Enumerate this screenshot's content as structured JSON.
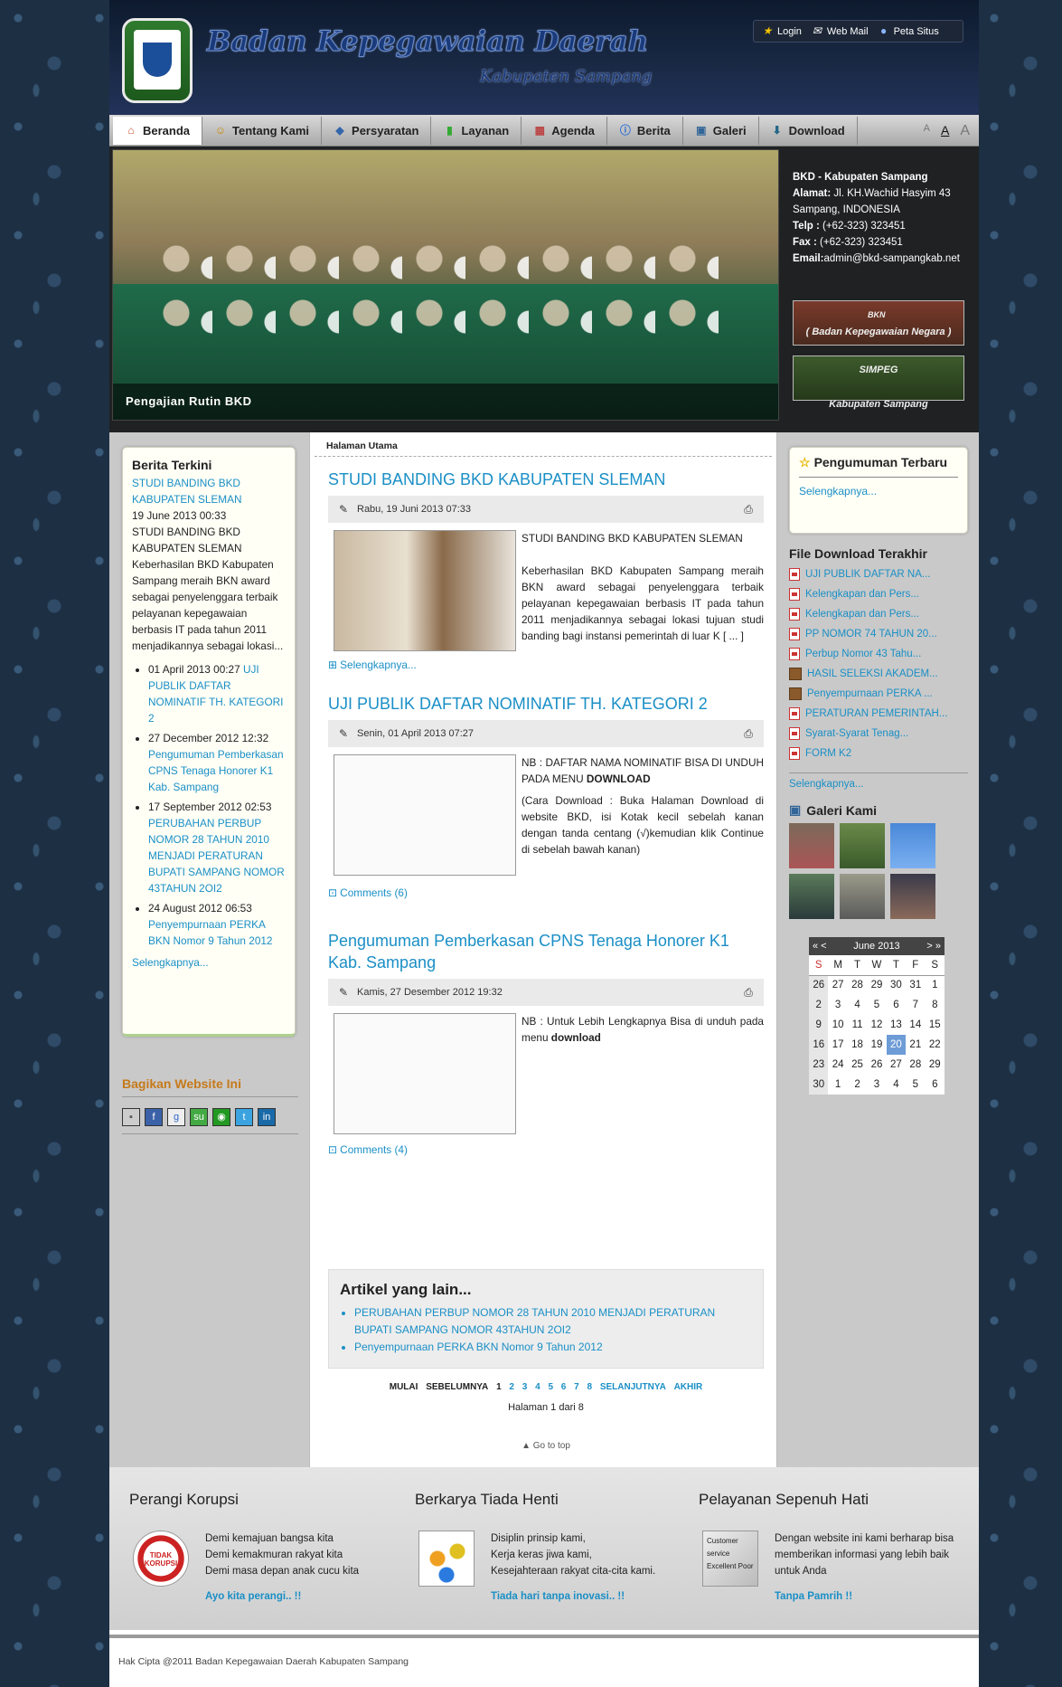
{
  "header": {
    "title": "Badan Kepegawaian Daerah",
    "subtitle": "Kabupaten Sampang",
    "links": [
      {
        "label": "Login"
      },
      {
        "label": "Web Mail"
      },
      {
        "label": "Peta Situs"
      }
    ]
  },
  "nav": {
    "items": [
      {
        "label": "Beranda"
      },
      {
        "label": "Tentang Kami"
      },
      {
        "label": "Persyaratan"
      },
      {
        "label": "Layanan"
      },
      {
        "label": "Agenda"
      },
      {
        "label": "Berita"
      },
      {
        "label": "Galeri"
      },
      {
        "label": "Download"
      }
    ],
    "font_sizes": [
      "A",
      "A",
      "A"
    ]
  },
  "slider": {
    "caption": "Pengajian Rutin BKD"
  },
  "contact": {
    "org": "BKD - Kabupaten Sampang",
    "alamat_label": "Alamat:",
    "alamat": "Jl. KH.Wachid Hasyim 43 Sampang, INDONESIA",
    "telp_label": "Telp :",
    "telp": "(+62-323) 323451",
    "fax_label": "Fax :",
    "fax": "(+62-323) 323451",
    "email_label": "Email:",
    "email": "admin@bkd-sampangkab.net"
  },
  "banners": {
    "bkn": "( Badan Kepegawaian Negara )",
    "bkn_small": "BKN",
    "simpeg": "SIMPEG",
    "simpeg_sub": "Kabupaten Sampang"
  },
  "left": {
    "berita_title": "Berita Terkini",
    "lead_link": "STUDI BANDING BKD KABUPATEN SLEMAN",
    "lead_date": "19 June 2013 00:33",
    "lead_text": "STUDI BANDING BKD KABUPATEN SLEMAN Keberhasilan BKD Kabupaten Sampang meraih BKN award sebagai penyelenggara terbaik pelayanan kepegawaian berbasis IT pada tahun 2011 menjadikannya sebagai lokasi...",
    "items": [
      {
        "date": "01 April 2013 00:27",
        "title": "UJI PUBLIK DAFTAR NOMINATIF TH. KATEGORI 2"
      },
      {
        "date": "27 December 2012 12:32",
        "title": "Pengumuman Pemberkasan CPNS Tenaga Honorer K1 Kab. Sampang"
      },
      {
        "date": "17 September 2012 02:53",
        "title": "PERUBAHAN PERBUP NOMOR 28 TAHUN 2010 MENJADI PERATURAN BUPATI SAMPANG NOMOR 43TAHUN 2OI2"
      },
      {
        "date": "24 August 2012 06:53",
        "title": "Penyempurnaan PERKA BKN Nomor 9 Tahun 2012"
      }
    ],
    "more": "Selengkapnya...",
    "share_title": "Bagikan Website Ini"
  },
  "main": {
    "breadcrumb": "Halaman Utama",
    "articles": [
      {
        "title": "STUDI BANDING BKD KABUPATEN SLEMAN",
        "date": "Rabu, 19 Juni 2013 07:33",
        "text1": "STUDI BANDING BKD KABUPATEN SLEMAN",
        "text2": "Keberhasilan BKD Kabupaten Sampang meraih BKN award sebagai penyelenggara terbaik pelayanan kepegawaian berbasis IT pada tahun 2011 menjadikannya sebagai lokasi tujuan studi banding bagi instansi pemerintah di luar K [ ... ]",
        "link": "Selengkapnya..."
      },
      {
        "title": "UJI PUBLIK DAFTAR NOMINATIF TH. KATEGORI 2",
        "date": "Senin, 01 April 2013 07:27",
        "text1": "NB : DAFTAR NAMA NOMINATIF BISA DI UNDUH PADA MENU",
        "bold1": "DOWNLOAD",
        "text2": "(Cara Download : Buka Halaman Download di website BKD, isi Kotak kecil sebelah kanan dengan tanda centang (√)kemudian klik Continue di sebelah bawah kanan)",
        "link": "Comments (6)"
      },
      {
        "title": "Pengumuman Pemberkasan CPNS Tenaga Honorer K1 Kab. Sampang",
        "date": "Kamis, 27 Desember 2012 19:32",
        "text1": "NB : Untuk Lebih Lengkapnya Bisa di unduh pada menu",
        "bold1": "download",
        "link": "Comments (4)"
      }
    ],
    "other_title": "Artikel yang lain...",
    "other": [
      "PERUBAHAN PERBUP NOMOR 28 TAHUN 2010 MENJADI PERATURAN BUPATI SAMPANG NOMOR 43TAHUN 2OI2",
      "Penyempurnaan PERKA BKN Nomor 9 Tahun 2012"
    ],
    "pager": {
      "first": "MULAI",
      "prev": "SEBELUMNYA",
      "pages": [
        "1",
        "2",
        "3",
        "4",
        "5",
        "6",
        "7",
        "8"
      ],
      "next": "SELANJUTNYA",
      "last": "AKHIR"
    },
    "page_info": "Halaman 1 dari 8",
    "go_top": "Go to top"
  },
  "right": {
    "pengumuman_title": "Pengumuman Terbaru",
    "pengumuman_more": "Selengkapnya...",
    "files_title": "File Download Terakhir",
    "files": [
      {
        "name": "UJI PUBLIK DAFTAR NA...",
        "type": "pdf"
      },
      {
        "name": "Kelengkapan dan Pers...",
        "type": "pdf"
      },
      {
        "name": "Kelengkapan dan Pers...",
        "type": "pdf"
      },
      {
        "name": "PP NOMOR 74 TAHUN 20...",
        "type": "pdf"
      },
      {
        "name": "Perbup Nomor 43 Tahu...",
        "type": "pdf"
      },
      {
        "name": "HASIL SELEKSI AKADEM...",
        "type": "rar"
      },
      {
        "name": "Penyempurnaan PERKA ...",
        "type": "rar"
      },
      {
        "name": "PERATURAN PEMERINTAH...",
        "type": "pdf"
      },
      {
        "name": "Syarat-Syarat Tenag...",
        "type": "pdf"
      },
      {
        "name": "FORM K2",
        "type": "pdf"
      }
    ],
    "files_more": "Selengkapnya...",
    "galeri_title": "Galeri Kami",
    "calendar": {
      "nav_left": "« <",
      "month": "June 2013",
      "nav_right": "> »",
      "days": [
        "S",
        "M",
        "T",
        "W",
        "T",
        "F",
        "S"
      ],
      "rows": [
        [
          "26",
          "27",
          "28",
          "29",
          "30",
          "31",
          "1"
        ],
        [
          "2",
          "3",
          "4",
          "5",
          "6",
          "7",
          "8"
        ],
        [
          "9",
          "10",
          "11",
          "12",
          "13",
          "14",
          "15"
        ],
        [
          "16",
          "17",
          "18",
          "19",
          "20",
          "21",
          "22"
        ],
        [
          "23",
          "24",
          "25",
          "26",
          "27",
          "28",
          "29"
        ],
        [
          "30",
          "1",
          "2",
          "3",
          "4",
          "5",
          "6"
        ]
      ]
    }
  },
  "footer": {
    "cols": [
      {
        "title": "Perangi Korupsi",
        "lines": [
          "Demi kemajuan bangsa kita",
          "Demi kemakmuran rakyat kita",
          "Demi masa depan anak cucu kita"
        ],
        "tag": "Ayo kita perangi.. !!",
        "img_text": "TIDAK KORUPSI"
      },
      {
        "title": "Berkarya Tiada Henti",
        "lines": [
          "Disiplin prinsip kami,",
          "Kerja keras jiwa kami,",
          "Kesejahteraan rakyat cita-cita kami."
        ],
        "tag": "Tiada hari tanpa inovasi.. !!"
      },
      {
        "title": "Pelayanan Sepenuh Hati",
        "lines": [
          "Dengan website ini kami berharap bisa memberikan informasi yang lebih baik untuk Anda"
        ],
        "tag": "Tanpa Pamrih !!",
        "img_text": "Customer service Excellent Poor"
      }
    ],
    "copyright": "Hak Cipta @2011 Badan Kepegawaian Daerah Kabupaten Sampang"
  }
}
